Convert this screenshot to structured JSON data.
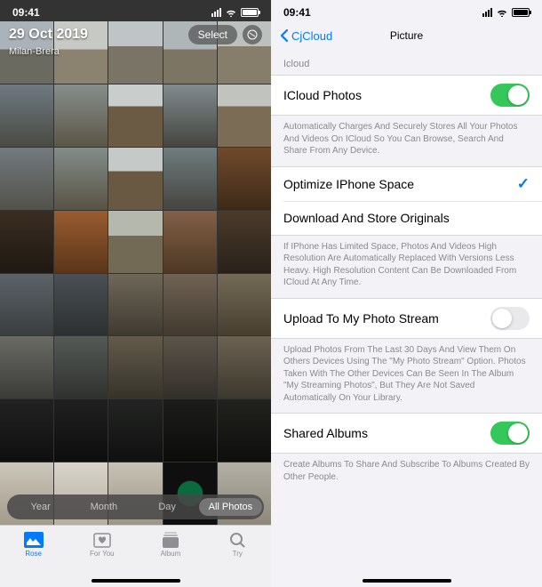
{
  "status": {
    "time": "09:41"
  },
  "photos": {
    "date": "29 Oct 2019",
    "location": "Milan-Brera",
    "select_label": "Select",
    "segments": [
      "Year",
      "Month",
      "Day",
      "All Photos"
    ],
    "tabs": [
      {
        "label": "Rose"
      },
      {
        "label": "For You"
      },
      {
        "label": "Album"
      },
      {
        "label": "Try"
      }
    ]
  },
  "settings": {
    "back": "CjCloud",
    "title": "Picture",
    "section1_header": "Icloud",
    "icloud_photos": {
      "label": "ICloud Photos",
      "description": "Automatically Charges And Securely Stores All Your Photos And Videos On ICloud So You Can Browse, Search And Share From Any Device."
    },
    "optimize_label": "Optimize IPhone Space",
    "download_label": "Download And Store Originals",
    "storage_desc": "If IPhone Has Limited Space, Photos And Videos High Resolution Are Automatically Replaced With Versions Less Heavy. High Resolution Content Can Be Downloaded From ICloud At Any Time.",
    "photo_stream": {
      "label": "Upload To My Photo Stream",
      "description": "Upload Photos From The Last 30 Days And View Them On Others Devices Using The \"My Photo Stream\" Option. Photos Taken With The Other Devices Can Be Seen In The Album \"My Streaming Photos\", But They Are Not Saved Automatically On Your Library."
    },
    "shared_albums": {
      "label": "Shared Albums",
      "description": "Create Albums To Share And Subscribe To Albums Created By Other People."
    }
  }
}
